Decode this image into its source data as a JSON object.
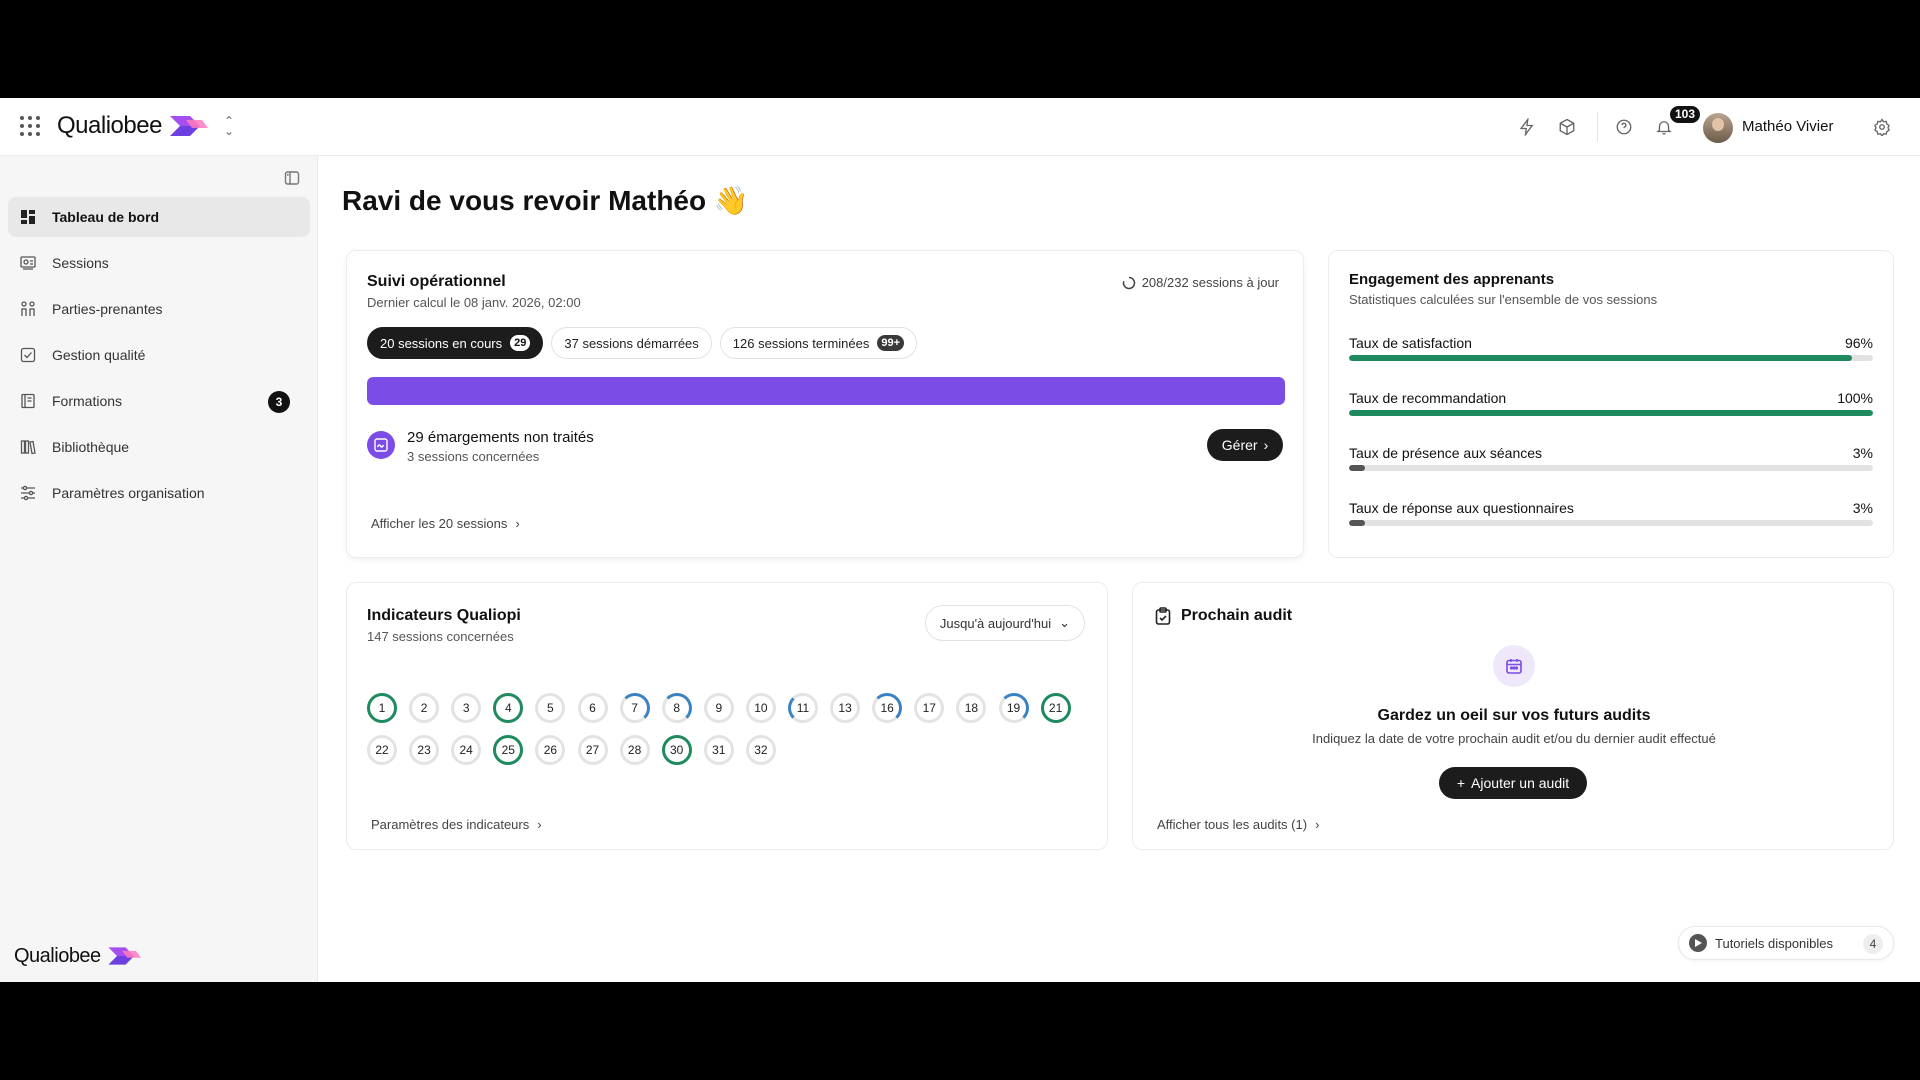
{
  "header": {
    "app_name": "Qualiobee",
    "notifications_count": "103",
    "user_name": "Mathéo Vivier"
  },
  "sidebar": {
    "items": [
      {
        "label": "Tableau de bord",
        "icon": "dashboard-icon",
        "active": true
      },
      {
        "label": "Sessions",
        "icon": "sessions-icon"
      },
      {
        "label": "Parties-prenantes",
        "icon": "people-icon"
      },
      {
        "label": "Gestion qualité",
        "icon": "checkbox-icon"
      },
      {
        "label": "Formations",
        "icon": "book-icon",
        "badge": "3"
      },
      {
        "label": "Bibliothèque",
        "icon": "library-icon"
      },
      {
        "label": "Paramètres organisation",
        "icon": "sliders-icon"
      }
    ],
    "footer_logo": "Qualiobee"
  },
  "main": {
    "welcome": "Ravi de vous revoir Mathéo 👋"
  },
  "suivi": {
    "title": "Suivi opérationnel",
    "subtitle": "Dernier calcul le 08 janv. 2026, 02:00",
    "status": "208/232 sessions à jour",
    "pills": [
      {
        "label": "20 sessions en cours",
        "count": "29"
      },
      {
        "label": "37 sessions démarrées"
      },
      {
        "label": "126 sessions terminées",
        "count": "99+"
      }
    ],
    "progress_fraction": 1.0,
    "emargements_title": "29 émargements non traités",
    "emargements_sub": "3 sessions concernées",
    "manage_label": "Gérer",
    "link": "Afficher les 20 sessions"
  },
  "engagement": {
    "title": "Engagement des apprenants",
    "subtitle": "Statistiques calculées sur l'ensemble de vos sessions",
    "metrics": [
      {
        "label": "Taux de satisfaction",
        "value": "96%",
        "fraction": 0.96,
        "color": "#1f8a5e"
      },
      {
        "label": "Taux de recommandation",
        "value": "100%",
        "fraction": 1.0,
        "color": "#1f8a5e"
      },
      {
        "label": "Taux de présence aux séances",
        "value": "3%",
        "fraction": 0.03,
        "color": "#555555"
      },
      {
        "label": "Taux de réponse aux questionnaires",
        "value": "3%",
        "fraction": 0.03,
        "color": "#555555"
      }
    ]
  },
  "indicateurs": {
    "title": "Indicateurs Qualiopi",
    "subtitle": "147 sessions concernées",
    "filter": "Jusqu'à aujourd'hui",
    "items": [
      {
        "n": "1",
        "state": "green"
      },
      {
        "n": "2",
        "state": "none"
      },
      {
        "n": "3",
        "state": "none"
      },
      {
        "n": "4",
        "state": "green"
      },
      {
        "n": "5",
        "state": "none"
      },
      {
        "n": "6",
        "state": "none"
      },
      {
        "n": "7",
        "state": "blue-r"
      },
      {
        "n": "8",
        "state": "blue-r"
      },
      {
        "n": "9",
        "state": "none"
      },
      {
        "n": "10",
        "state": "none"
      },
      {
        "n": "11",
        "state": "blue-l"
      },
      {
        "n": "13",
        "state": "none"
      },
      {
        "n": "16",
        "state": "blue-r"
      },
      {
        "n": "17",
        "state": "none"
      },
      {
        "n": "18",
        "state": "none"
      },
      {
        "n": "19",
        "state": "blue-r"
      },
      {
        "n": "21",
        "state": "green"
      },
      {
        "n": "22",
        "state": "none"
      },
      {
        "n": "23",
        "state": "none"
      },
      {
        "n": "24",
        "state": "none"
      },
      {
        "n": "25",
        "state": "green"
      },
      {
        "n": "26",
        "state": "none"
      },
      {
        "n": "27",
        "state": "none"
      },
      {
        "n": "28",
        "state": "none"
      },
      {
        "n": "30",
        "state": "green"
      },
      {
        "n": "31",
        "state": "none"
      },
      {
        "n": "32",
        "state": "none"
      }
    ],
    "link": "Paramètres des indicateurs"
  },
  "audit": {
    "title": "Prochain audit",
    "empty_title": "Gardez un oeil sur vos futurs audits",
    "empty_sub": "Indiquez la date de votre prochain audit et/ou du dernier audit effectué",
    "add_label": "Ajouter un audit",
    "link": "Afficher tous les audits (1)"
  },
  "tutorials": {
    "label": "Tutoriels disponibles",
    "count": "4"
  }
}
